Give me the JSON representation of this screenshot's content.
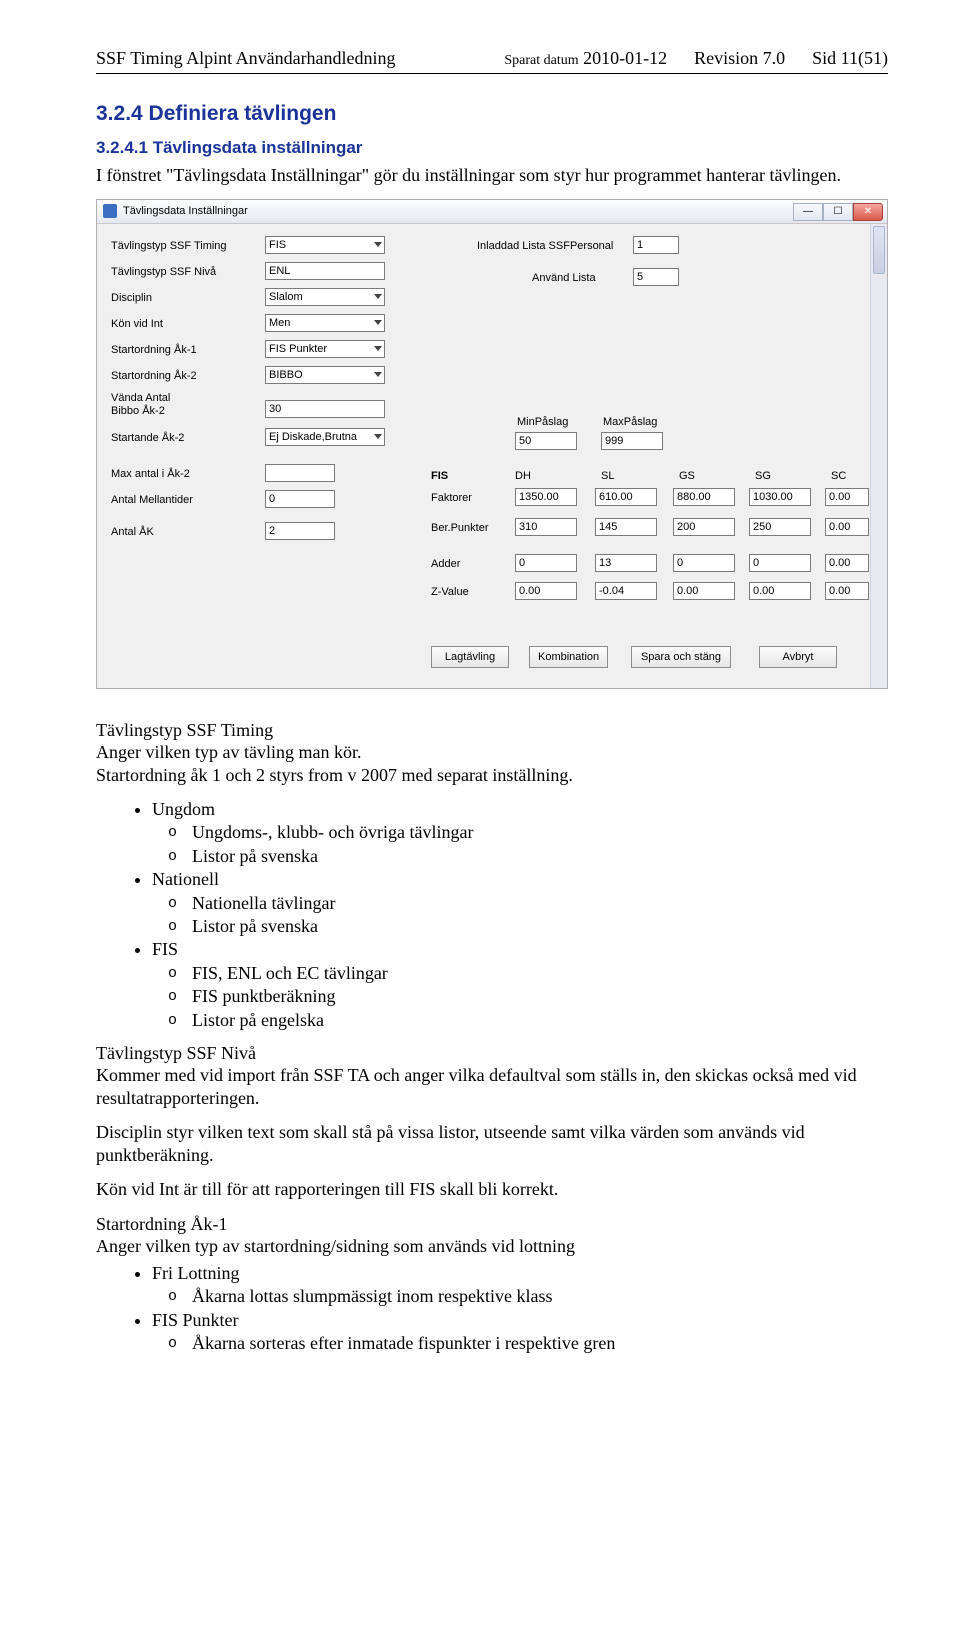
{
  "header": {
    "left": "SSF Timing Alpint Användarhandledning",
    "saved_label": "Sparat datum",
    "saved_date": "2010-01-12",
    "revision": "Revision 7.0",
    "page": "Sid 11(51)"
  },
  "sections": {
    "s324_title": "3.2.4  Definiera tävlingen",
    "s3241_title": "3.2.4.1  Tävlingsdata inställningar",
    "s3241_body": "I fönstret \"Tävlingsdata Inställningar\" gör du inställningar som styr hur programmet hanterar tävlingen."
  },
  "dialog": {
    "title": "Tävlingsdata Inställningar",
    "left_labels": {
      "typ_timing": "Tävlingstyp SSF Timing",
      "typ_niva": "Tävlingstyp SSF Nivå",
      "disciplin": "Disciplin",
      "kon": "Kön vid Int",
      "startordning1": "Startordning Åk-1",
      "startordning2": "Startordning Åk-2",
      "vanda": "Vända Antal",
      "bibbo2": "Bibbo Åk-2",
      "startande2": "Startande Åk-2",
      "max_antal": "Max antal i Åk-2",
      "antal_mellan": "Antal Mellantider",
      "antal_ak": "Antal ÅK"
    },
    "left_values": {
      "typ_timing": "FIS",
      "typ_niva": "ENL",
      "disciplin": "Slalom",
      "kon": "Men",
      "startordning1": "FIS Punkter",
      "startordning2": "BIBBO",
      "vanda_number": "30",
      "startande2": "Ej Diskade,Brutna",
      "max_antal": "",
      "antal_mellan": "0",
      "antal_ak": "2"
    },
    "right_top": {
      "inladdad_label": "Inladdad Lista SSFPersonal",
      "inladdad_value": "1",
      "anvand_label": "Använd Lista",
      "anvand_value": "5"
    },
    "minmax": {
      "min_label": "MinPåslag",
      "max_label": "MaxPåslag",
      "min_value": "50",
      "max_value": "999"
    },
    "fis_block": {
      "title": "FIS",
      "col_headers": [
        "DH",
        "SL",
        "GS",
        "SG",
        "SC"
      ],
      "rows": [
        {
          "label": "Faktorer",
          "values": [
            "1350.00",
            "610.00",
            "880.00",
            "1030.00",
            "0.00"
          ]
        },
        {
          "label": "Ber.Punkter",
          "values": [
            "310",
            "145",
            "200",
            "250",
            "0.00"
          ]
        },
        {
          "label": "Adder",
          "values": [
            "0",
            "13",
            "0",
            "0",
            "0.00"
          ]
        },
        {
          "label": "Z-Value",
          "values": [
            "0.00",
            "-0.04",
            "0.00",
            "0.00",
            "0.00"
          ]
        }
      ]
    },
    "buttons": {
      "lag": "Lagtävling",
      "kombi": "Kombination",
      "spara": "Spara och stäng",
      "avbryt": "Avbryt"
    },
    "winbtn_min": "—",
    "winbtn_max": "☐",
    "winbtn_close": "✕"
  },
  "body_after": {
    "p1_head": "Tävlingstyp SSF Timing",
    "p1": "Anger vilken typ av tävling man kör.",
    "p2": "Startordning åk 1 och 2 styrs from v 2007 med separat inställning.",
    "bullets": [
      {
        "label": "Ungdom",
        "subs": [
          "Ungdoms-, klubb- och övriga tävlingar",
          "Listor på svenska"
        ]
      },
      {
        "label": "Nationell",
        "subs": [
          "Nationella tävlingar",
          "Listor på svenska"
        ]
      },
      {
        "label": "FIS",
        "subs": [
          "FIS, ENL och EC tävlingar",
          "FIS punktberäkning",
          "Listor på engelska"
        ]
      }
    ],
    "niva_head": "Tävlingstyp SSF Nivå",
    "niva_body": "Kommer med vid import från SSF TA och anger vilka defaultval som ställs in, den skickas också med vid resultatrapporteringen.",
    "disc_body": "Disciplin styr vilken text som skall stå på vissa listor, utseende samt vilka värden som används vid punktberäkning.",
    "kon_body": "Kön vid Int är till för att rapporteringen till FIS skall bli korrekt.",
    "start_head": "Startordning Åk-1",
    "start_body": "Anger vilken typ av startordning/sidning som används vid lottning",
    "start_bullets": [
      {
        "label": "Fri Lottning",
        "subs": [
          "Åkarna lottas slumpmässigt inom respektive klass"
        ]
      },
      {
        "label": "FIS Punkter",
        "subs": [
          "Åkarna sorteras efter inmatade fispunkter i respektive gren"
        ]
      }
    ]
  }
}
